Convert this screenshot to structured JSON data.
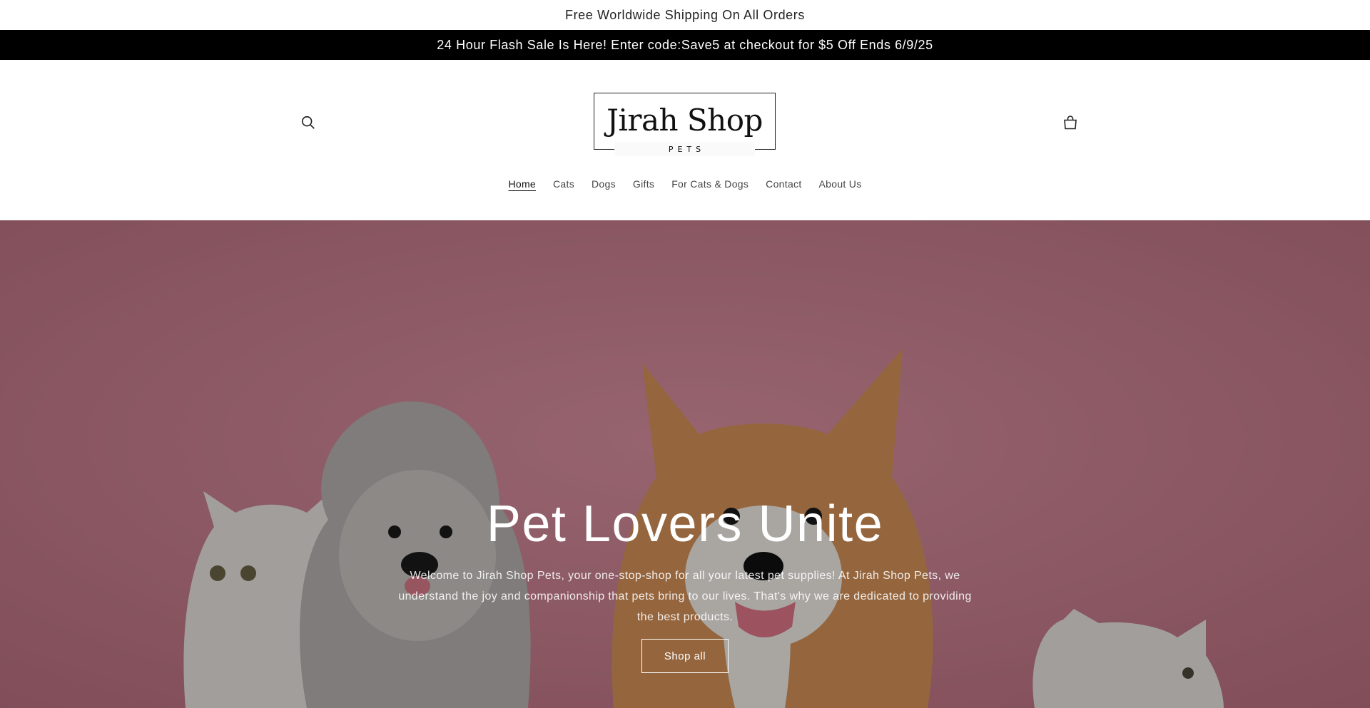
{
  "announcements": {
    "top": "Free Worldwide Shipping On All Orders",
    "sale": "24 Hour Flash Sale Is Here! Enter code:Save5 at checkout for $5 Off Ends 6/9/25"
  },
  "header": {
    "logo_main": "Jirah Shop",
    "logo_sub": "PETS",
    "search_icon": "search-icon",
    "cart_icon": "cart-icon"
  },
  "nav": {
    "items": [
      {
        "label": "Home",
        "active": true
      },
      {
        "label": "Cats"
      },
      {
        "label": "Dogs"
      },
      {
        "label": "Gifts"
      },
      {
        "label": "For Cats & Dogs"
      },
      {
        "label": "Contact"
      },
      {
        "label": "About Us"
      }
    ]
  },
  "hero": {
    "title": "Pet Lovers Unite",
    "text": "Welcome to Jirah Shop Pets, your one-stop-shop for all your latest pet supplies! At Jirah Shop Pets, we understand the joy and companionship that pets bring to our lives. That's why we are dedicated to providing the best products.",
    "button_label": "Shop all",
    "background_color": "#c98796"
  }
}
